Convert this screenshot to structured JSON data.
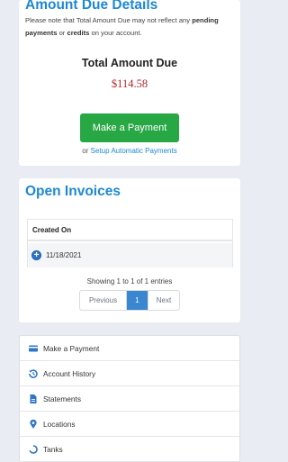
{
  "amount_due": {
    "title": "Amount Due Details",
    "notice_prefix": "Please note that Total Amount Due may not reflect any",
    "notice_bold1": "pending payments",
    "notice_mid": "or",
    "notice_bold2": "credits",
    "notice_suffix": "on your account.",
    "total_label": "Total Amount Due",
    "total_value": "$114.58",
    "pay_button": "Make a Payment",
    "or_text": "or",
    "setup_link": "Setup Automatic Payments"
  },
  "invoices": {
    "title": "Open Invoices",
    "column_header": "Created On",
    "rows": [
      {
        "created_on": "11/18/2021"
      }
    ],
    "showing": "Showing 1 to 1 of 1 entries",
    "pager": {
      "previous": "Previous",
      "current": "1",
      "next": "Next"
    }
  },
  "nav": {
    "items": [
      {
        "label": "Make a Payment",
        "icon": "credit-card-icon"
      },
      {
        "label": "Account History",
        "icon": "history-icon"
      },
      {
        "label": "Statements",
        "icon": "file-icon"
      },
      {
        "label": "Locations",
        "icon": "map-marker-icon"
      },
      {
        "label": "Tanks",
        "icon": "tank-icon"
      }
    ]
  },
  "colors": {
    "accent": "#1e88d4",
    "pay_button": "#28a745",
    "amount": "#b3282a",
    "background": "#e9ecf2"
  }
}
